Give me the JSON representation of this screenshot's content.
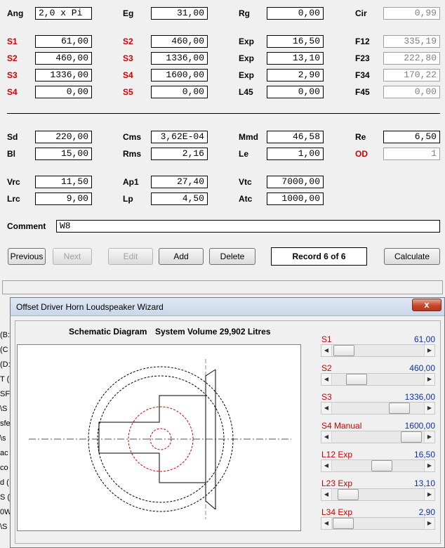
{
  "form": {
    "rows": [
      [
        {
          "label": "Ang",
          "value": "2,0 x Pi",
          "red": false
        },
        {
          "label": "Eg",
          "value": "31,00",
          "red": false
        },
        {
          "label": "Rg",
          "value": "0,00",
          "red": false
        },
        {
          "label": "Cir",
          "value": "0,99",
          "red": false,
          "readonly": true
        }
      ],
      [
        {
          "label": "S1",
          "value": "61,00",
          "red": true
        },
        {
          "label": "S2",
          "value": "460,00",
          "red": true
        },
        {
          "label": "Exp",
          "value": "16,50",
          "red": false
        },
        {
          "label": "F12",
          "value": "335,19",
          "red": false,
          "readonly": true
        }
      ],
      [
        {
          "label": "S2",
          "value": "460,00",
          "red": true
        },
        {
          "label": "S3",
          "value": "1336,00",
          "red": true
        },
        {
          "label": "Exp",
          "value": "13,10",
          "red": false
        },
        {
          "label": "F23",
          "value": "222,80",
          "red": false,
          "readonly": true
        }
      ],
      [
        {
          "label": "S3",
          "value": "1336,00",
          "red": true
        },
        {
          "label": "S4",
          "value": "1600,00",
          "red": true
        },
        {
          "label": "Exp",
          "value": "2,90",
          "red": false
        },
        {
          "label": "F34",
          "value": "170,22",
          "red": false,
          "readonly": true
        }
      ],
      [
        {
          "label": "S4",
          "value": "0,00",
          "red": true
        },
        {
          "label": "S5",
          "value": "0,00",
          "red": true
        },
        {
          "label": "L45",
          "value": "0,00",
          "red": false
        },
        {
          "label": "F45",
          "value": "0,00",
          "red": false,
          "readonly": true
        }
      ],
      [
        {
          "label": "Sd",
          "value": "220,00",
          "red": false
        },
        {
          "label": "Cms",
          "value": "3,62E-04",
          "red": false
        },
        {
          "label": "Mmd",
          "value": "46,58",
          "red": false
        },
        {
          "label": "Re",
          "value": "6,50",
          "red": false
        }
      ],
      [
        {
          "label": "Bl",
          "value": "15,00",
          "red": false
        },
        {
          "label": "Rms",
          "value": "2,16",
          "red": false
        },
        {
          "label": "Le",
          "value": "1,00",
          "red": false
        },
        {
          "label": "OD",
          "value": "1",
          "red": true,
          "readonly": true
        }
      ],
      [
        {
          "label": "Vrc",
          "value": "11,50",
          "red": false
        },
        {
          "label": "Ap1",
          "value": "27,40",
          "red": false
        },
        {
          "label": "Vtc",
          "value": "7000,00",
          "red": false
        }
      ],
      [
        {
          "label": "Lrc",
          "value": "9,00",
          "red": false
        },
        {
          "label": "Lp",
          "value": "4,50",
          "red": false
        },
        {
          "label": "Atc",
          "value": "1000,00",
          "red": false
        }
      ]
    ],
    "comment_label": "Comment",
    "comment_value": "W8"
  },
  "buttons": {
    "previous": "Previous",
    "next": "Next",
    "edit": "Edit",
    "add": "Add",
    "delete": "Delete",
    "record": "Record 6 of 6",
    "calculate": "Calculate"
  },
  "background_window": {
    "fragments": [
      "(B:",
      "(C",
      "(D:",
      "T (",
      "SF",
      "\\S",
      "sfe",
      "\\s",
      "ac",
      "co",
      "d (",
      "S (",
      "0W",
      "\\S"
    ]
  },
  "wizard": {
    "title": "Offset Driver Horn Loudspeaker Wizard",
    "close_glyph": "x",
    "diagram_title": "Schematic Diagram",
    "system_volume": "System Volume 29,902 Litres",
    "sliders": [
      {
        "label": "S1",
        "value": "61,00",
        "level": 0.02
      },
      {
        "label": "S2",
        "value": "460,00",
        "level": 0.2
      },
      {
        "label": "S3",
        "value": "1336,00",
        "level": 0.8
      },
      {
        "label": "S4  Manual",
        "value": "1600,00",
        "level": 0.97
      },
      {
        "label": "L12  Exp",
        "value": "16,50",
        "level": 0.55
      },
      {
        "label": "L23  Exp",
        "value": "13,10",
        "level": 0.08
      },
      {
        "label": "L34  Exp",
        "value": "2,90",
        "level": 0.01
      }
    ]
  },
  "colors": {
    "red_label": "#d00000",
    "value_blue": "#1030b0",
    "close_button": "#c7472c"
  },
  "icons": {
    "close": "close-icon",
    "arrow_left": "left-arrow-icon",
    "arrow_right": "right-arrow-icon"
  }
}
